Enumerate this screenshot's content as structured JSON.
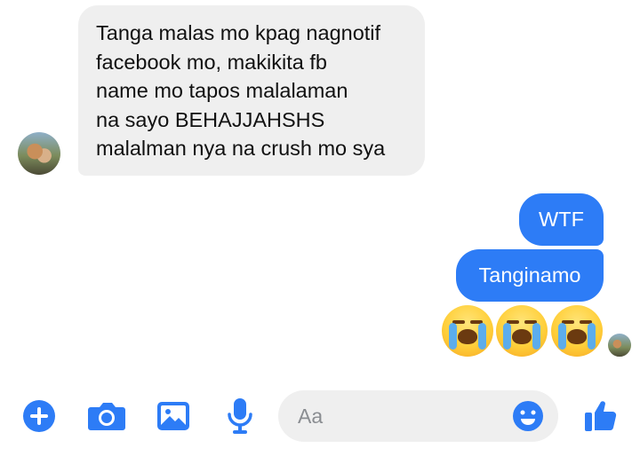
{
  "conversation": {
    "incoming_message": "Tanga malas mo kpag nagnotif\nfacebook mo, makikita fb\nname mo tapos malalaman\nna sayo BEHAJJAHSHS\nmalalman nya na crush mo sya",
    "outgoing_messages": [
      "WTF",
      "Tanginamo"
    ],
    "reaction_emojis": [
      "loudly-crying-face",
      "loudly-crying-face",
      "loudly-crying-face"
    ]
  },
  "composer": {
    "placeholder": "Aa",
    "icons": [
      "plus-icon",
      "camera-icon",
      "image-icon",
      "microphone-icon",
      "emoji-icon",
      "thumbs-up-icon"
    ]
  },
  "colors": {
    "accent": "#2d7cf6",
    "incoming_bubble": "#efefef",
    "input_background": "#efefef"
  }
}
